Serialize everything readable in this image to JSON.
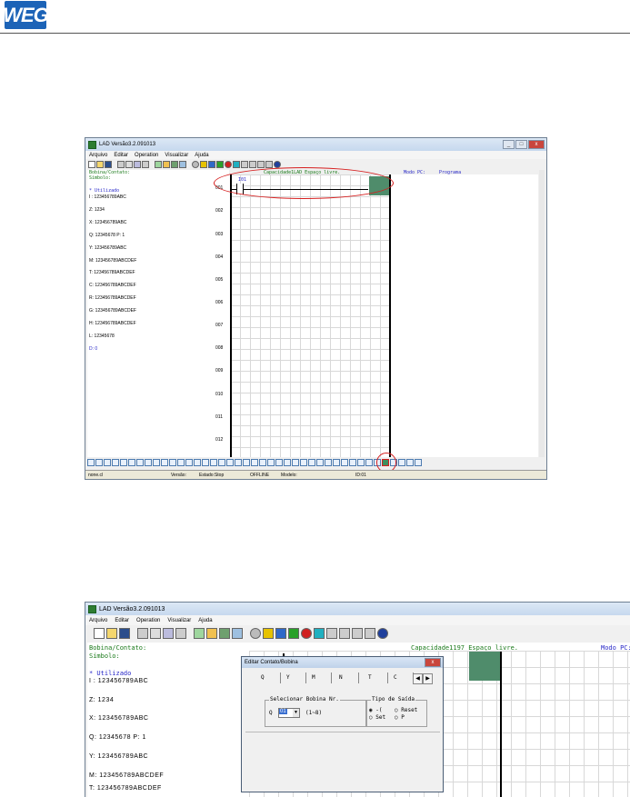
{
  "header": {
    "logo_text": "WEG"
  },
  "colors": {
    "accent_green": "#4f8c6b",
    "annotation_red": "#d61f1f",
    "text_green": "#1a7a1a",
    "text_blue": "#2828c8"
  },
  "win1": {
    "title": "LAD Versão3.2.091013",
    "menu": [
      "Arquivo",
      "Editar",
      "Operation",
      "Visualizar",
      "Ajuda"
    ],
    "info": {
      "bobina": "Bobina/Contato:",
      "simbolo": "Símbolo:",
      "capacidade": "Capacidade1LAD Espaço livre.",
      "modo_pc": "Modo PC:",
      "programa": "Programa"
    },
    "used_label": "* Utilizado",
    "vars": [
      "I : 123456789ABC",
      "Z: 1234",
      "X: 123456789ABC",
      "Q: 12345678  P: 1",
      "Y: 123456789ABC",
      "M: 123456789ABCDEF",
      "T: 123456789ABCDEF",
      "C: 123456789ABCDEF",
      "R: 123456789ABCDEF",
      "G: 123456789ABCDEF",
      "H: 123456789ABCDEF",
      "L: 12345678",
      "D:  0"
    ],
    "rows": [
      "001",
      "002",
      "003",
      "004",
      "005",
      "006",
      "007",
      "008",
      "009",
      "010",
      "011",
      "012"
    ],
    "contact_label": "I01",
    "status": {
      "file": "none.cl",
      "versao": "Versão:",
      "estado": "Estado:Stop",
      "conn": "OFFLINE",
      "modelo": "Modelo:",
      "id": "ID:01"
    }
  },
  "win2": {
    "title": "LAD Versão3.2.091013",
    "menu": [
      "Arquivo",
      "Editar",
      "Operation",
      "Visualizar",
      "Ajuda"
    ],
    "info": {
      "bobina": "Bobina/Contato:",
      "simbolo": "Símbolo:",
      "capacidade": "Capacidade1197 Espaço livre.",
      "modo_pc": "Modo PC:"
    },
    "used_label": "* Utilizado",
    "vars": [
      "I : 123456789ABC",
      "Z: 1234",
      "X: 123456789ABC",
      "Q: 12345678  P: 1",
      "Y: 123456789ABC",
      "M: 123456789ABCDEF",
      "T: 123456789ABCDEF"
    ]
  },
  "dialog": {
    "title": "Editar Contato/Bobina",
    "tabs": [
      "Q",
      "Y",
      "M",
      "N",
      "T",
      "C"
    ],
    "group1": "Selecionar Bobina Nr.",
    "coil_prefix": "Q",
    "coil_value": "01",
    "range": "(1~8)",
    "group2": "Tipo de Saída",
    "opts": [
      "-(",
      "Reset",
      "Set",
      "P"
    ]
  }
}
